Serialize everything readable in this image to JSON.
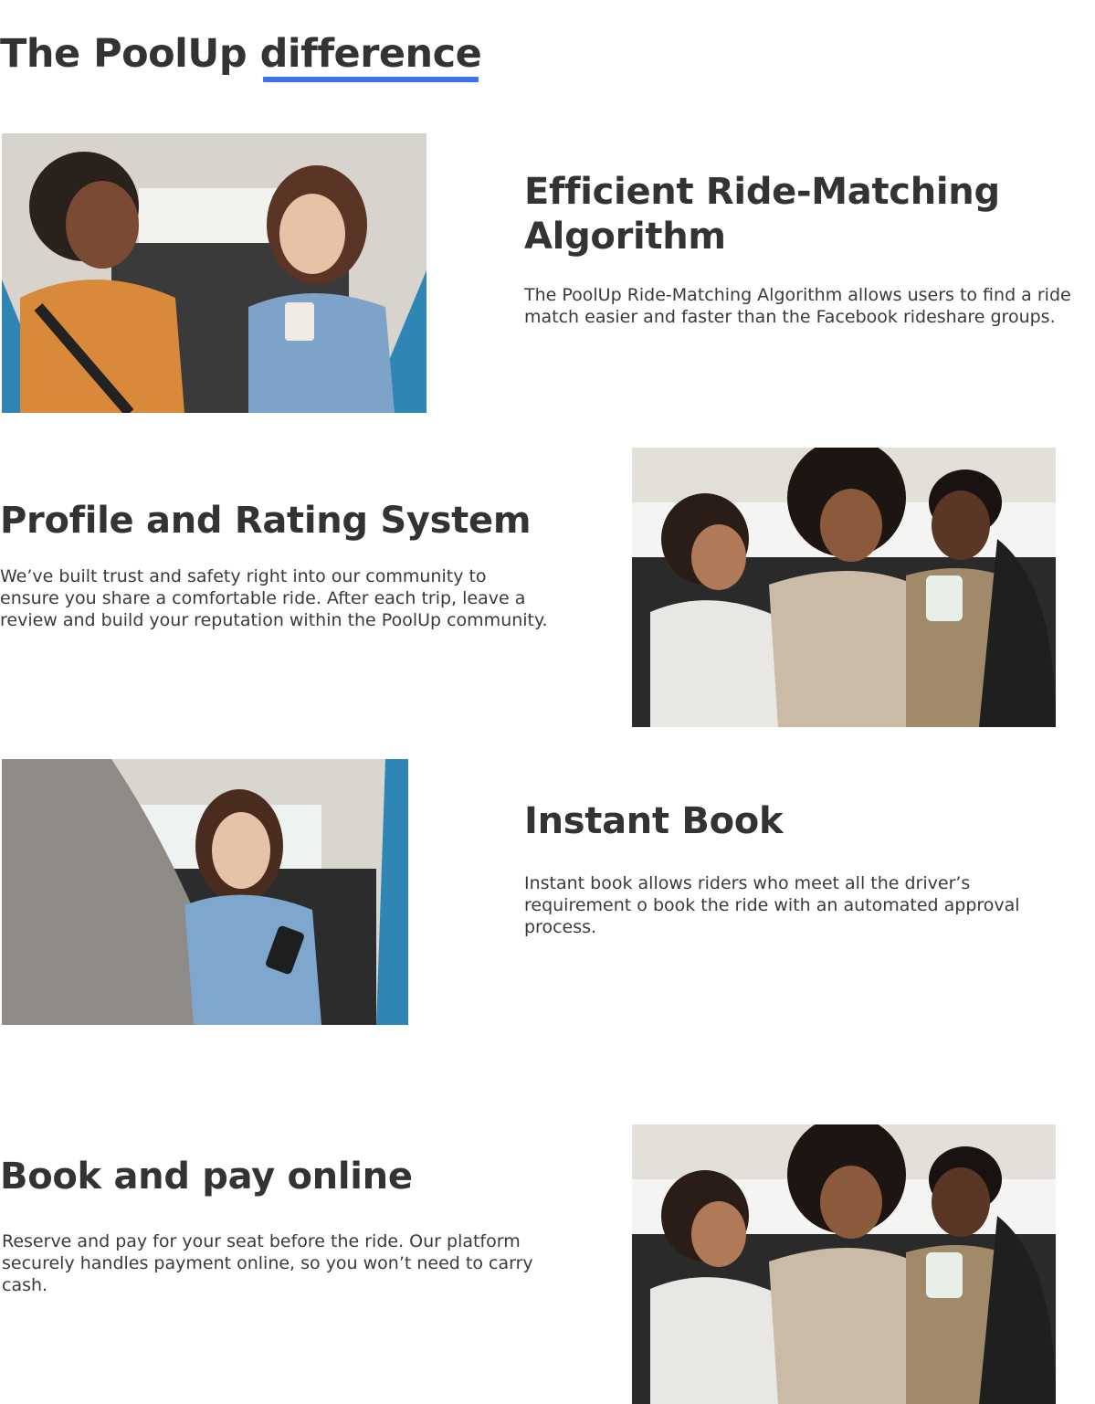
{
  "header": {
    "title_prefix": "The PoolUp ",
    "title_highlight": "difference"
  },
  "features": [
    {
      "title": "Efficient Ride-Matching Algorithm",
      "text": "The PoolUp Ride-Matching Algorithm allows users to find a ride match easier and faster than the Facebook rideshare groups.",
      "image": "two-women-in-car-photo"
    },
    {
      "title": "Profile and Rating System",
      "text": "We’ve built trust and safety right into our community to ensure you share a comfortable ride. After each trip, leave a review and build your reputation within the PoolUp community.",
      "image": "three-friends-in-car-photo"
    },
    {
      "title": "Instant Book",
      "text": "Instant book allows riders who meet all the driver’s requirement o book the ride with an automated approval process.",
      "image": "woman-with-phone-in-car-photo"
    },
    {
      "title": "Book and pay online",
      "text": "Reserve and pay for your seat before the ride. Our platform securely handles payment online, so you won’t need to carry cash.",
      "image": "three-friends-in-car-photo"
    }
  ],
  "colors": {
    "accent": "#3d72e8",
    "text": "#333333"
  }
}
